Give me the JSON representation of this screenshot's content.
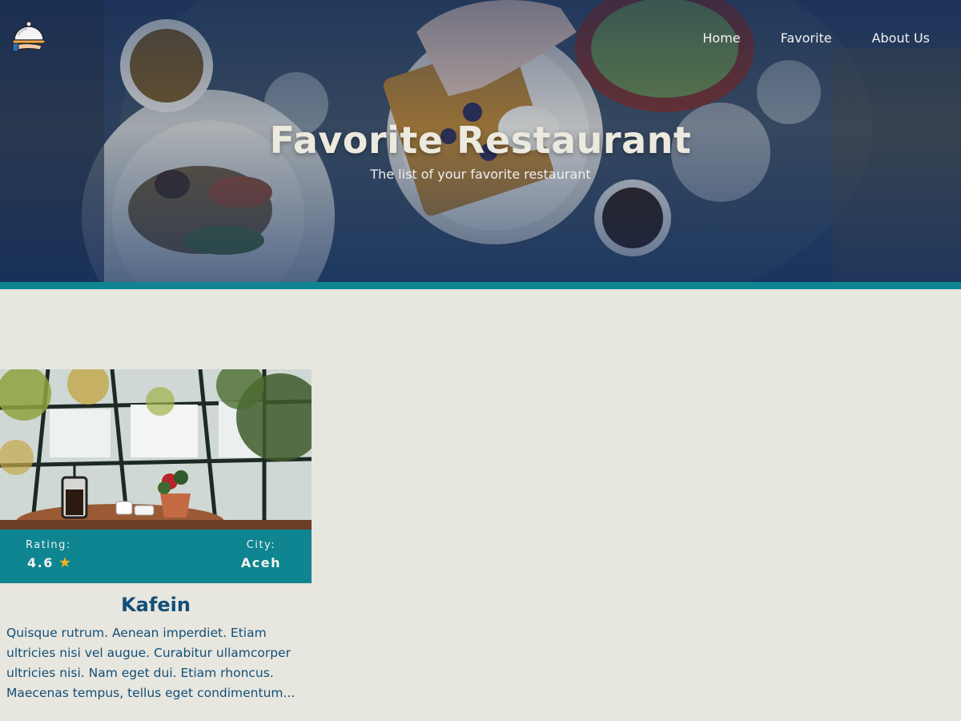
{
  "header": {
    "logo_icon": "serving-cloche-icon",
    "nav": [
      {
        "label": "Home"
      },
      {
        "label": "Favorite"
      },
      {
        "label": "About Us"
      }
    ]
  },
  "hero": {
    "title": "Favorite Restaurant",
    "subtitle": "The list of your favorite restaurant"
  },
  "restaurants": [
    {
      "name": "Kafein",
      "rating_label": "Rating:",
      "rating": "4.6",
      "rating_icon": "star-icon",
      "city_label": "City:",
      "city": "Aceh",
      "description": "Quisque rutrum. Aenean imperdiet. Etiam ultricies nisi vel augue. Curabitur ullamcorper ultricies nisi. Nam eget dui. Etiam rhoncus. Maecenas tempus, tellus eget condimentum..."
    }
  ],
  "colors": {
    "accent": "#0e8590",
    "title": "#134f78",
    "background": "#e7e6df",
    "star": "#f6b21a"
  }
}
